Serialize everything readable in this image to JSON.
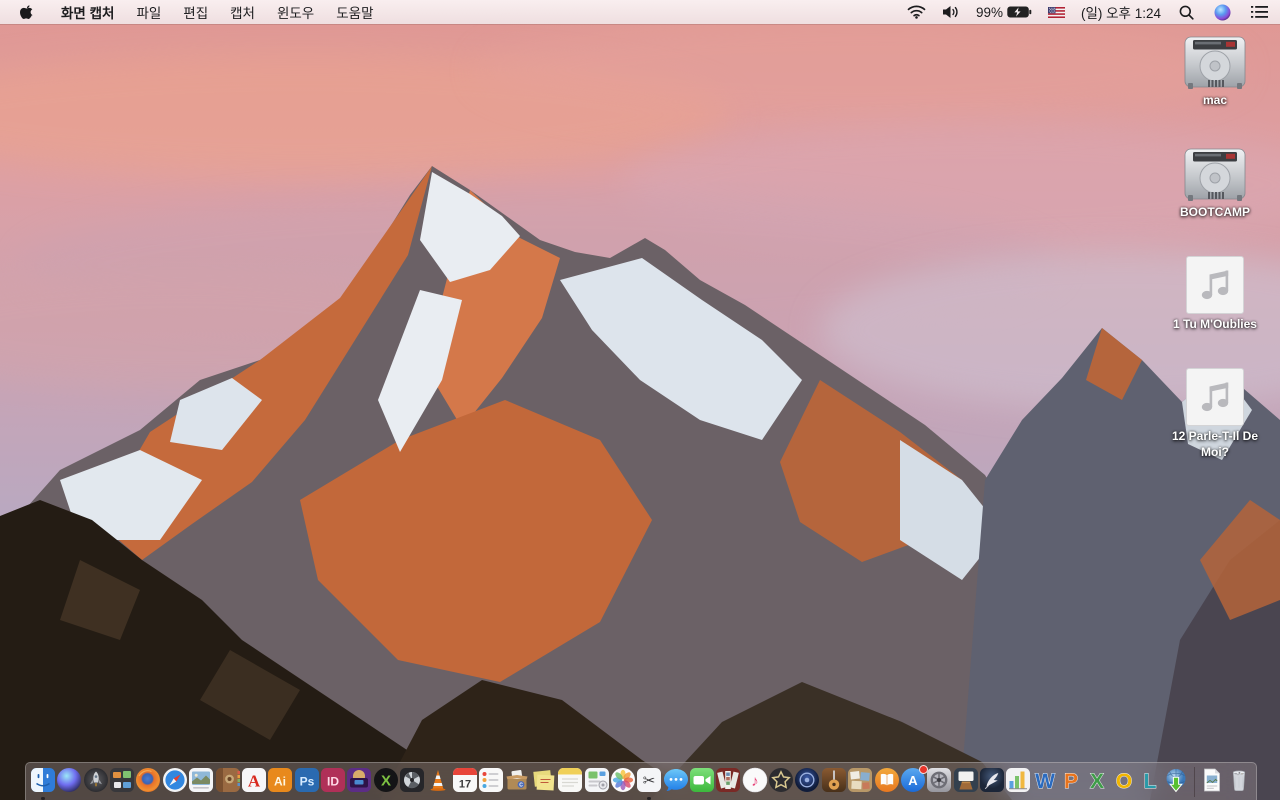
{
  "menu_bar": {
    "app_name": "화면 캡처",
    "menus": [
      "파일",
      "편집",
      "캡처",
      "윈도우",
      "도움말"
    ],
    "status": {
      "battery_percent": "99%",
      "battery_charging": true,
      "input_language_flag": "us-flag",
      "clock": "(일) 오후 1:24"
    },
    "status_icons": [
      "wifi-icon",
      "volume-icon",
      "battery-charging-icon",
      "us-flag-icon",
      "spotlight-search-icon",
      "siri-icon",
      "notification-center-icon"
    ]
  },
  "desktop": {
    "wallpaper": "sierra-mountain-sunset",
    "icons": [
      {
        "name": "mac",
        "label": "mac",
        "type": "hard-drive"
      },
      {
        "name": "bootcamp",
        "label": "BOOTCAMP",
        "type": "hard-drive"
      },
      {
        "name": "music-1",
        "label": "1 Tu M'Oublies",
        "type": "audio-file"
      },
      {
        "name": "music-2",
        "label": "12 Parle-T-Il De Moi?",
        "type": "audio-file"
      }
    ]
  },
  "dock": {
    "items": [
      {
        "name": "finder",
        "icon": "finder-icon",
        "running": true
      },
      {
        "name": "siri",
        "icon": "siri-orb-icon"
      },
      {
        "name": "launchpad",
        "icon": "launchpad-rocket-icon"
      },
      {
        "name": "mission-control",
        "icon": "mission-control-icon"
      },
      {
        "name": "firefox",
        "icon": "firefox-icon"
      },
      {
        "name": "safari",
        "icon": "safari-compass-icon"
      },
      {
        "name": "preview",
        "icon": "preview-photo-icon"
      },
      {
        "name": "contacts",
        "icon": "address-book-icon"
      },
      {
        "name": "acrobat-reader",
        "icon": "acrobat-a-icon"
      },
      {
        "name": "illustrator",
        "icon": "adobe-tile-icon",
        "letter": "Ai",
        "color": "#e8891c",
        "fg": "#fff6e0"
      },
      {
        "name": "photoshop",
        "icon": "adobe-tile-icon",
        "letter": "Ps",
        "color": "#2a6ab0",
        "fg": "#d6ebff"
      },
      {
        "name": "indesign",
        "icon": "adobe-tile-icon",
        "letter": "ID",
        "color": "#b03058",
        "fg": "#ffd9e6"
      },
      {
        "name": "toast-titanium",
        "icon": "toaster-icon"
      },
      {
        "name": "x-media-app",
        "icon": "green-x-circle-icon"
      },
      {
        "name": "disk-tool",
        "icon": "disk-fan-icon"
      },
      {
        "name": "vlc",
        "icon": "traffic-cone-icon"
      },
      {
        "name": "calendar",
        "icon": "calendar-icon",
        "date": "17"
      },
      {
        "name": "reminders",
        "icon": "reminders-list-icon"
      },
      {
        "name": "archive-box-app",
        "icon": "archive-box-icon"
      },
      {
        "name": "stickies",
        "icon": "sticky-notes-icon"
      },
      {
        "name": "notes",
        "icon": "notepad-icon"
      },
      {
        "name": "documents-app",
        "icon": "documents-chart-icon"
      },
      {
        "name": "photos",
        "icon": "photos-pinwheel-icon"
      },
      {
        "name": "screen-capture-grab",
        "icon": "scissors-icon",
        "running": true
      },
      {
        "name": "messages",
        "icon": "chat-bubble-icon"
      },
      {
        "name": "facetime",
        "icon": "video-camera-icon"
      },
      {
        "name": "photo-booth",
        "icon": "photo-strips-icon"
      },
      {
        "name": "itunes",
        "icon": "music-note-circle-icon"
      },
      {
        "name": "imovie",
        "icon": "star-circle-icon"
      },
      {
        "name": "idvd",
        "icon": "dvd-disc-icon"
      },
      {
        "name": "garageband",
        "icon": "guitar-icon"
      },
      {
        "name": "scrapbook-app",
        "icon": "collage-board-icon"
      },
      {
        "name": "ibooks",
        "icon": "open-book-icon"
      },
      {
        "name": "app-store",
        "icon": "app-store-a-icon",
        "badge": true
      },
      {
        "name": "system-preferences",
        "icon": "gear-wheel-icon"
      },
      {
        "name": "keynote",
        "icon": "podium-icon"
      },
      {
        "name": "pages",
        "icon": "quill-icon"
      },
      {
        "name": "numbers",
        "icon": "bar-chart-icon"
      },
      {
        "name": "microsoft-word",
        "icon": "office-letter-icon",
        "letter": "W",
        "color": "#2b6bbf"
      },
      {
        "name": "microsoft-powerpoint",
        "icon": "office-letter-icon",
        "letter": "P",
        "color": "#e8731c"
      },
      {
        "name": "microsoft-excel",
        "icon": "office-letter-icon",
        "letter": "X",
        "color": "#3f9c49"
      },
      {
        "name": "microsoft-outlook",
        "icon": "office-letter-icon",
        "letter": "O",
        "color": "#f0b500"
      },
      {
        "name": "microsoft-lync",
        "icon": "office-letter-icon",
        "letter": "L",
        "color": "#2a9aa8"
      },
      {
        "name": "download-manager",
        "icon": "globe-download-icon"
      },
      {
        "name": "separator",
        "icon": "separator"
      },
      {
        "name": "document-file",
        "icon": "document-file-icon"
      },
      {
        "name": "trash-full",
        "icon": "trash-icon"
      }
    ]
  },
  "colors": {
    "menubar_tint": "#f6eef0",
    "dock_tint": "rgba(150,140,142,0.40)",
    "badge_red": "#e8352a"
  }
}
